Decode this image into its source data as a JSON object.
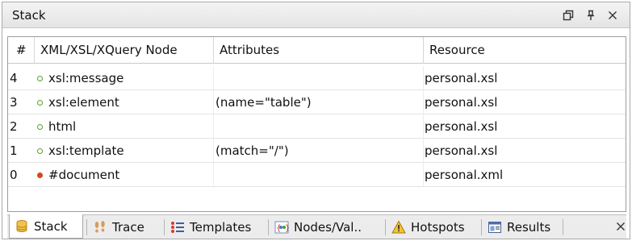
{
  "panel": {
    "title": "Stack",
    "restore_icon": "restore-window-icon",
    "pin_icon": "pin-icon",
    "close_icon": "close-icon"
  },
  "table": {
    "columns": [
      "#",
      "XML/XSL/XQuery Node",
      "Attributes",
      "Resource"
    ],
    "rows": [
      {
        "index": "4",
        "node": "xsl:message",
        "status": "green",
        "attributes": "",
        "resource": "personal.xsl"
      },
      {
        "index": "3",
        "node": "xsl:element",
        "status": "green",
        "attributes": "(name=\"table\")",
        "resource": "personal.xsl"
      },
      {
        "index": "2",
        "node": "html",
        "status": "green",
        "attributes": "",
        "resource": "personal.xsl"
      },
      {
        "index": "1",
        "node": "xsl:template",
        "status": "green",
        "attributes": "(match=\"/\")",
        "resource": "personal.xsl"
      },
      {
        "index": "0",
        "node": "#document",
        "status": "red",
        "attributes": "",
        "resource": "personal.xml"
      }
    ]
  },
  "tabs": [
    {
      "label": "Stack",
      "icon": "stack-icon",
      "active": true
    },
    {
      "label": "Trace",
      "icon": "trace-footprints-icon",
      "active": false
    },
    {
      "label": "Templates",
      "icon": "templates-list-icon",
      "active": false
    },
    {
      "label": "Nodes/Val..",
      "icon": "nodes-values-icon",
      "active": false
    },
    {
      "label": "Hotspots",
      "icon": "hotspots-warning-icon",
      "active": false
    },
    {
      "label": "Results",
      "icon": "results-window-icon",
      "active": false
    }
  ],
  "tabstrip": {
    "close_icon": "close-icon"
  },
  "colors": {
    "ok": "#5aa02c",
    "error": "#d9441b"
  }
}
